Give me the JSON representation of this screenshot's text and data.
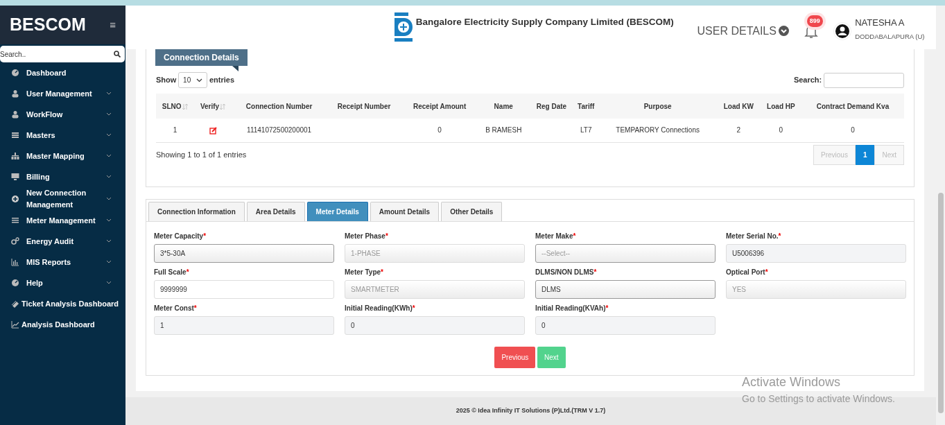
{
  "sidebar": {
    "brand": "BESCOM",
    "menu_toggle": "≡",
    "search": {
      "placeholder": "Search.."
    },
    "items": [
      {
        "label": "Dashboard",
        "expandable": false,
        "indent": true
      },
      {
        "label": "User Management",
        "expandable": true,
        "indent": true
      },
      {
        "label": "WorkFlow",
        "expandable": true,
        "indent": true
      },
      {
        "label": "Masters",
        "expandable": true,
        "indent": true
      },
      {
        "label": "Master Mapping",
        "expandable": true,
        "indent": true
      },
      {
        "label": "Billing",
        "expandable": true,
        "indent": true
      },
      {
        "label": "New Connection Management",
        "expandable": true,
        "indent": true
      },
      {
        "label": "Meter Management",
        "expandable": true,
        "indent": true
      },
      {
        "label": "Energy Audit",
        "expandable": true,
        "indent": true
      },
      {
        "label": "MIS Reports",
        "expandable": true,
        "indent": true
      },
      {
        "label": "Help",
        "expandable": true,
        "indent": true
      },
      {
        "label": "Ticket Analysis Dashboard",
        "expandable": false,
        "indent": false
      },
      {
        "label": "Analysis Dashboard",
        "expandable": false,
        "indent": false
      }
    ]
  },
  "header": {
    "title": "Bangalore Electricity Supply Company Limited (BESCOM)",
    "user_details": "USER DETAILS",
    "notification_count": "899",
    "user_name": "NATESHA A",
    "user_location": "DODDABALAPURA (U)"
  },
  "connection_details": {
    "title": "Connection Details",
    "show_label": "Show",
    "page_size": "10",
    "entries_label": "entries",
    "search_label": "Search:",
    "columns": [
      {
        "label": "SLNO",
        "sortable": true,
        "kind": "text"
      },
      {
        "label": "Verify",
        "sortable": true,
        "kind": "action"
      },
      {
        "label": "Connection Number",
        "sortable": false,
        "kind": "text"
      },
      {
        "label": "Receipt Number",
        "sortable": false,
        "kind": "text"
      },
      {
        "label": "Receipt Amount",
        "sortable": false,
        "kind": "text"
      },
      {
        "label": "Name",
        "sortable": false,
        "kind": "text"
      },
      {
        "label": "Reg Date",
        "sortable": false,
        "kind": "text"
      },
      {
        "label": "Tariff",
        "sortable": false,
        "kind": "text"
      },
      {
        "label": "Purpose",
        "sortable": false,
        "kind": "text"
      },
      {
        "label": "Load KW",
        "sortable": false,
        "kind": "text"
      },
      {
        "label": "Load HP",
        "sortable": false,
        "kind": "text"
      },
      {
        "label": "Contract Demand Kva",
        "sortable": false,
        "kind": "text"
      }
    ],
    "rows": [
      {
        "cells": [
          "1",
          null,
          "11141072500200001",
          null,
          "0",
          "B RAMESH",
          null,
          "LT7",
          "TEMPARORY Connections",
          "2",
          "0",
          "0"
        ]
      }
    ],
    "info": "Showing 1 to 1 of 1 entries",
    "pagination": [
      {
        "label": "Previous",
        "selected": false,
        "disabled": true
      },
      {
        "label": "1",
        "selected": true,
        "disabled": false
      },
      {
        "label": "Next",
        "selected": false,
        "disabled": true
      }
    ]
  },
  "tabs": [
    {
      "label": "Connection Information",
      "selected": false
    },
    {
      "label": "Area Details",
      "selected": false
    },
    {
      "label": "Meter Details",
      "selected": true
    },
    {
      "label": "Amount Details",
      "selected": false
    },
    {
      "label": "Other Details",
      "selected": false
    }
  ],
  "fields": [
    {
      "label": "Meter Capacity",
      "required_mark": "*",
      "kind": "select",
      "value": "3*5-30A",
      "disabled": false
    },
    {
      "label": "Meter Phase",
      "required_mark": "*",
      "kind": "select",
      "value": "1-PHASE",
      "disabled": true
    },
    {
      "label": "Meter Make",
      "required_mark": "*",
      "kind": "select",
      "placeholder": "--Select--",
      "disabled": false
    },
    {
      "label": "Meter Serial No.",
      "required_mark": "*",
      "kind": "readonly",
      "value": "U5006396"
    },
    {
      "label": "Full Scale",
      "required_mark": "*",
      "kind": "input",
      "value": "9999999"
    },
    {
      "label": "Meter Type",
      "required_mark": "*",
      "kind": "select",
      "value": "SMARTMETER",
      "disabled": true
    },
    {
      "label": "DLMS/NON DLMS",
      "required_mark": "*",
      "kind": "select",
      "value": "DLMS",
      "disabled": false
    },
    {
      "label": "Optical Port",
      "required_mark": "*",
      "kind": "select",
      "value": "YES",
      "disabled": true
    },
    {
      "label": "Meter Const",
      "required_mark": "*",
      "kind": "readonly",
      "value": "1"
    },
    {
      "label": "Initial Reading(KWh)",
      "required_mark": "*",
      "kind": "readonly",
      "value": "0"
    },
    {
      "label": "Initial Reading(KVAh)",
      "required_mark": "*",
      "kind": "readonly",
      "value": "0"
    }
  ],
  "buttons": [
    {
      "label": "Previous",
      "kind": "danger"
    },
    {
      "label": "Next",
      "kind": "success"
    }
  ],
  "footer": "2025 © Idea Infinity IT Solutions (P)Ltd.(TRM V 1.7)",
  "os_notice": {
    "title": "Activate Windows",
    "text": "Go to Settings to activate Windows."
  }
}
